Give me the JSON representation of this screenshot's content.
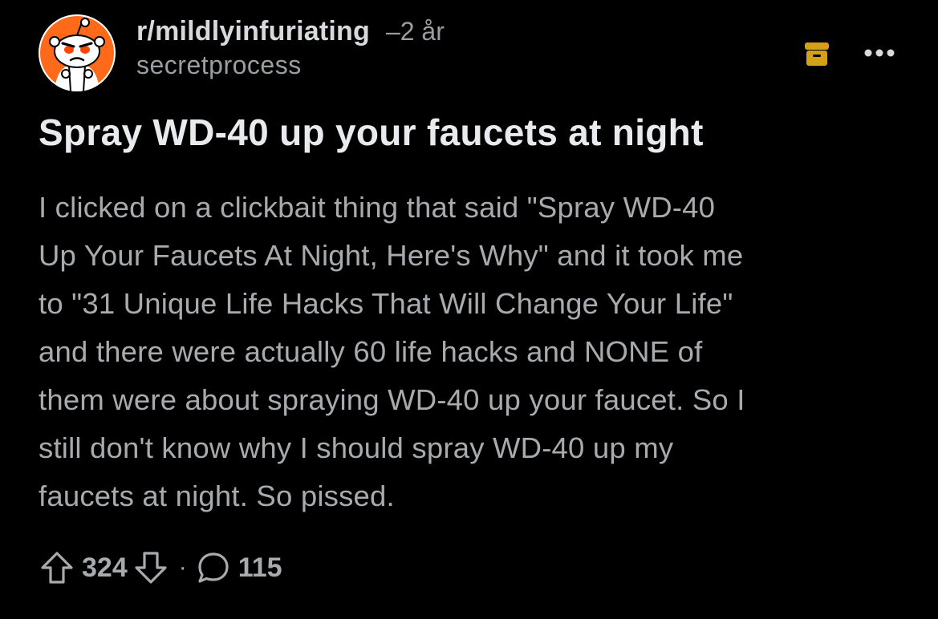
{
  "post": {
    "subreddit": "r/mildlyinfuriating",
    "time": "–2 år",
    "author": "secretprocess",
    "title": "Spray WD-40 up your faucets at night",
    "body_lines": [
      "I clicked on a clickbait thing that said \"Spray WD-40",
      "Up Your Faucets At Night, Here's Why\" and it took me",
      "to \"31 Unique Life Hacks That Will Change Your Life\"",
      "and there were actually 60 life hacks and NONE of",
      "them were about spraying WD-40 up your faucet. So I",
      "still don't know why I should spray WD-40 up my",
      "faucets at night. So pissed."
    ]
  },
  "actions": {
    "upvote_count": "324",
    "separator": "·",
    "comment_count": "115"
  },
  "icons": {
    "avatar": "subreddit-avatar-angry-snoo",
    "archive": "archive-icon",
    "more": "more-options-icon",
    "upvote": "upvote-arrow-icon",
    "downvote": "downvote-arrow-icon",
    "comment": "comment-bubble-icon"
  },
  "colors": {
    "background": "#000000",
    "avatar_orange": "#ff6a1a",
    "archive_gold": "#d4a017",
    "text_primary": "#e8eaed",
    "text_secondary": "#a8abae"
  }
}
